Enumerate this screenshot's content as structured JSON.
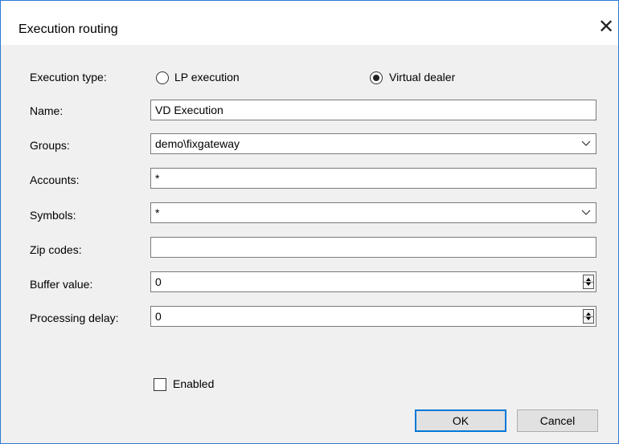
{
  "dialog": {
    "title": "Execution routing"
  },
  "execution_type": {
    "label": "Execution type:",
    "options": [
      {
        "label": "LP execution",
        "selected": false
      },
      {
        "label": "Virtual dealer",
        "selected": true
      }
    ]
  },
  "name": {
    "label": "Name:",
    "value": "VD Execution"
  },
  "groups": {
    "label": "Groups:",
    "value": "demo\\fixgateway"
  },
  "accounts": {
    "label": "Accounts:",
    "value": "*"
  },
  "symbols": {
    "label": "Symbols:",
    "value": "*"
  },
  "zip_codes": {
    "label": "Zip codes:",
    "value": ""
  },
  "buffer_value": {
    "label": "Buffer value:",
    "value": "0"
  },
  "processing_delay": {
    "label": "Processing delay:",
    "value": "0"
  },
  "enabled": {
    "label": "Enabled",
    "checked": false
  },
  "buttons": {
    "ok": "OK",
    "cancel": "Cancel"
  },
  "colors": {
    "accent": "#0078d7",
    "window_border": "#2b79d6",
    "dialog_bg": "#f0f0f0"
  }
}
